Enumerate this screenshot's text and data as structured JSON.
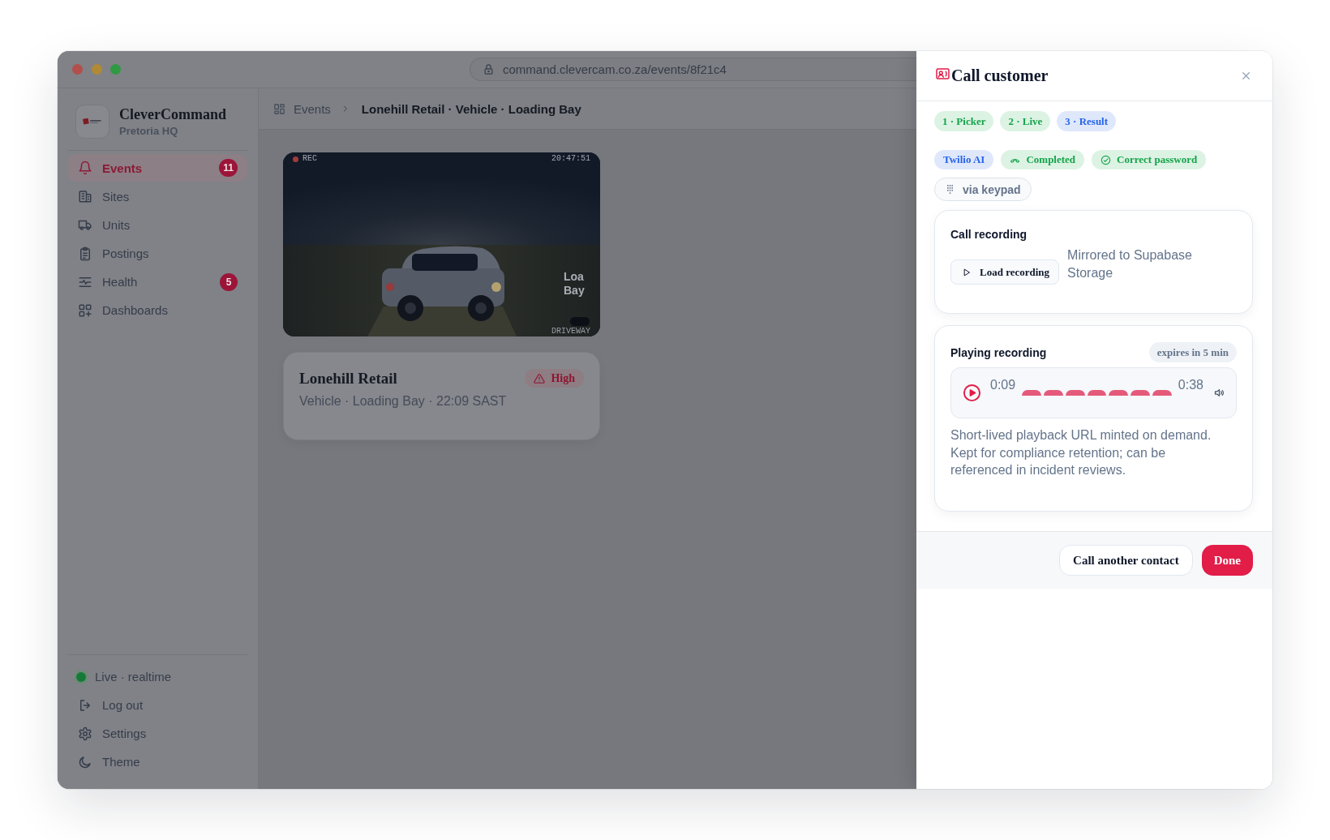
{
  "window": {
    "url": "command.clevercam.co.za/events/8f21c4"
  },
  "sidebar": {
    "brand": {
      "name": "CleverCommand",
      "subtitle": "Pretoria HQ"
    },
    "items": [
      {
        "label": "Events",
        "selected": true,
        "badge": "11"
      },
      {
        "label": "Sites",
        "selected": false
      },
      {
        "label": "Units",
        "selected": false
      },
      {
        "label": "Postings",
        "selected": false
      },
      {
        "label": "Health",
        "selected": false,
        "badge": "5"
      },
      {
        "label": "Dashboards",
        "selected": false
      }
    ],
    "footer_items": [
      {
        "kind": "status",
        "label": "Live · realtime",
        "online": true
      },
      {
        "kind": "link",
        "label": "Log out"
      },
      {
        "kind": "link",
        "label": "Settings"
      },
      {
        "kind": "link",
        "label": "Theme"
      }
    ]
  },
  "breadcrumb": {
    "parent": "Events",
    "current": "Lonehill Retail · Vehicle · Loading Bay"
  },
  "camera": {
    "rec_label": "REC",
    "timestamp": "20:47:51",
    "zone_label": "Loa Bay",
    "camera_label": "DRIVEWAY"
  },
  "event_card": {
    "site": "Lonehill Retail",
    "detail": "Vehicle · Loading Bay · 22:09 SAST",
    "severity": "High"
  },
  "dialog": {
    "title": "Call customer",
    "steps": [
      {
        "label": "1 · Picker",
        "selected": false
      },
      {
        "label": "2 · Live",
        "selected": false
      },
      {
        "label": "3 · Result",
        "selected": true
      }
    ],
    "tags": [
      {
        "kind": "provider",
        "label": "Twilio AI"
      },
      {
        "kind": "outcome",
        "label": "Completed"
      },
      {
        "kind": "check",
        "label": "Correct password"
      },
      {
        "kind": "method",
        "label": "via keypad"
      }
    ],
    "recording": {
      "title": "Call recording",
      "button": "Load recording",
      "note": "Mirrored to Supabase Storage"
    },
    "playback": {
      "title": "Playing recording",
      "expiry": "expires in 5 min",
      "elapsed": "0:09",
      "duration": "0:38",
      "note": "Short-lived playback URL minted on demand. Kept for compliance retention; can be referenced in incident reviews."
    },
    "actions": [
      {
        "kind": "secondary",
        "label": "Call another contact"
      },
      {
        "kind": "primary",
        "label": "Done"
      }
    ]
  }
}
